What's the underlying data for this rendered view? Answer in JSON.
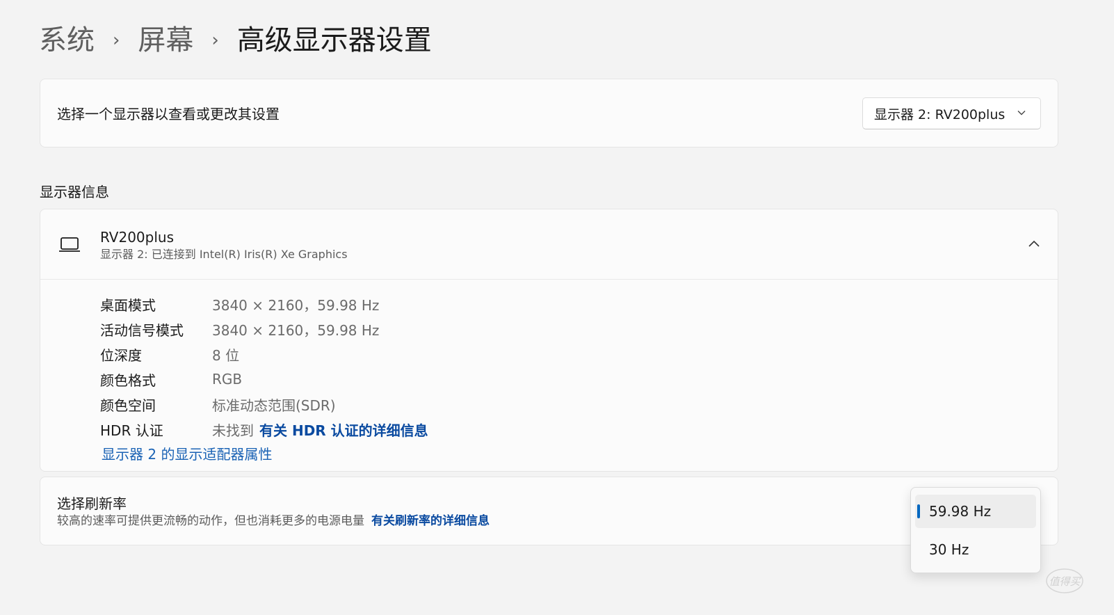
{
  "breadcrumb": {
    "item1": "系统",
    "sep": "›",
    "item2": "屏幕",
    "current": "高级显示器设置"
  },
  "select_card": {
    "label": "选择一个显示器以查看或更改其设置",
    "dropdown_value": "显示器 2: RV200plus"
  },
  "section_title": "显示器信息",
  "monitor": {
    "name": "RV200plus",
    "subtitle": "显示器 2: 已连接到 Intel(R) Iris(R) Xe Graphics",
    "rows": [
      {
        "key": "桌面模式",
        "value": "3840 × 2160，59.98 Hz"
      },
      {
        "key": "活动信号模式",
        "value": "3840 × 2160，59.98 Hz"
      },
      {
        "key": "位深度",
        "value": "8 位"
      },
      {
        "key": "颜色格式",
        "value": "RGB"
      },
      {
        "key": "颜色空间",
        "value": "标准动态范围(SDR)"
      },
      {
        "key": "HDR 认证",
        "value": "未找到",
        "link": "有关 HDR 认证的详细信息"
      }
    ],
    "adapter_link": "显示器 2 的显示适配器属性"
  },
  "refresh": {
    "title": "选择刷新率",
    "description": "较高的速率可提供更流畅的动作，但也消耗更多的电源电量",
    "link": "有关刷新率的详细信息",
    "options": [
      "59.98 Hz",
      "30 Hz"
    ],
    "selected": "59.98 Hz"
  },
  "watermark": "值得买",
  "colors": {
    "accent": "#0067c0",
    "link": "#0a4aa0",
    "background": "#f3f3f3",
    "card": "#fbfbfb"
  }
}
